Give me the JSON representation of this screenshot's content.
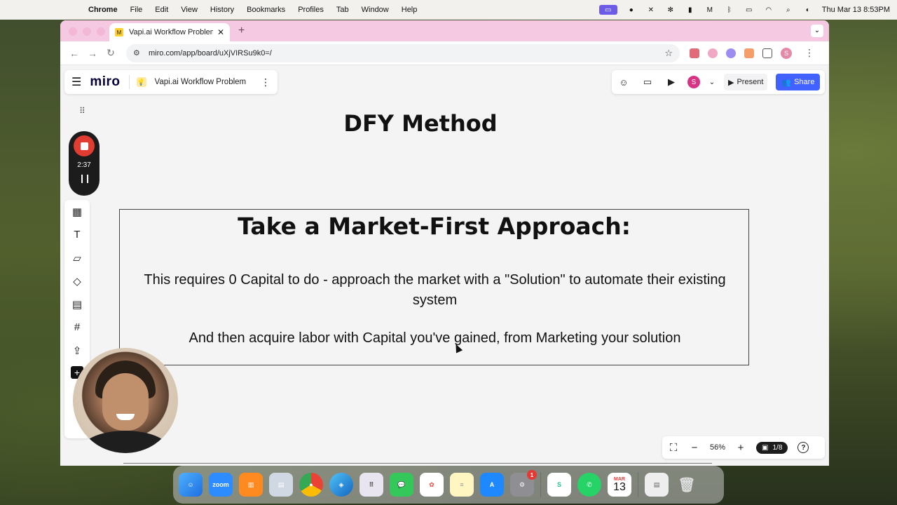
{
  "menubar": {
    "app": "Chrome",
    "items": [
      "File",
      "Edit",
      "View",
      "History",
      "Bookmarks",
      "Profiles",
      "Tab",
      "Window",
      "Help"
    ],
    "datetime": "Thu Mar 13  8:53PM"
  },
  "browser": {
    "tab_title": "Vapi.ai Workflow Problem - M",
    "url": "miro.com/app/board/uXjVIRSu9k0=/",
    "profile_initial": "S"
  },
  "miro": {
    "logo": "miro",
    "board_title": "Vapi.ai Workflow Problem",
    "user_initial": "S",
    "present_label": "Present",
    "share_label": "Share",
    "zoom": "56%",
    "pages": "1/8",
    "recording_time": "2:37"
  },
  "content": {
    "heading": "DFY Method",
    "card_title": "Take a Market-First Approach:",
    "card_p1": "This requires 0 Capital to do - approach the market with a \"Solution\" to automate their existing system",
    "card_p2": "And then acquire labor with Capital you've gained, from Marketing your solution"
  },
  "dock": {
    "calendar_month": "MAR",
    "calendar_day": "13",
    "settings_badge": "1"
  }
}
